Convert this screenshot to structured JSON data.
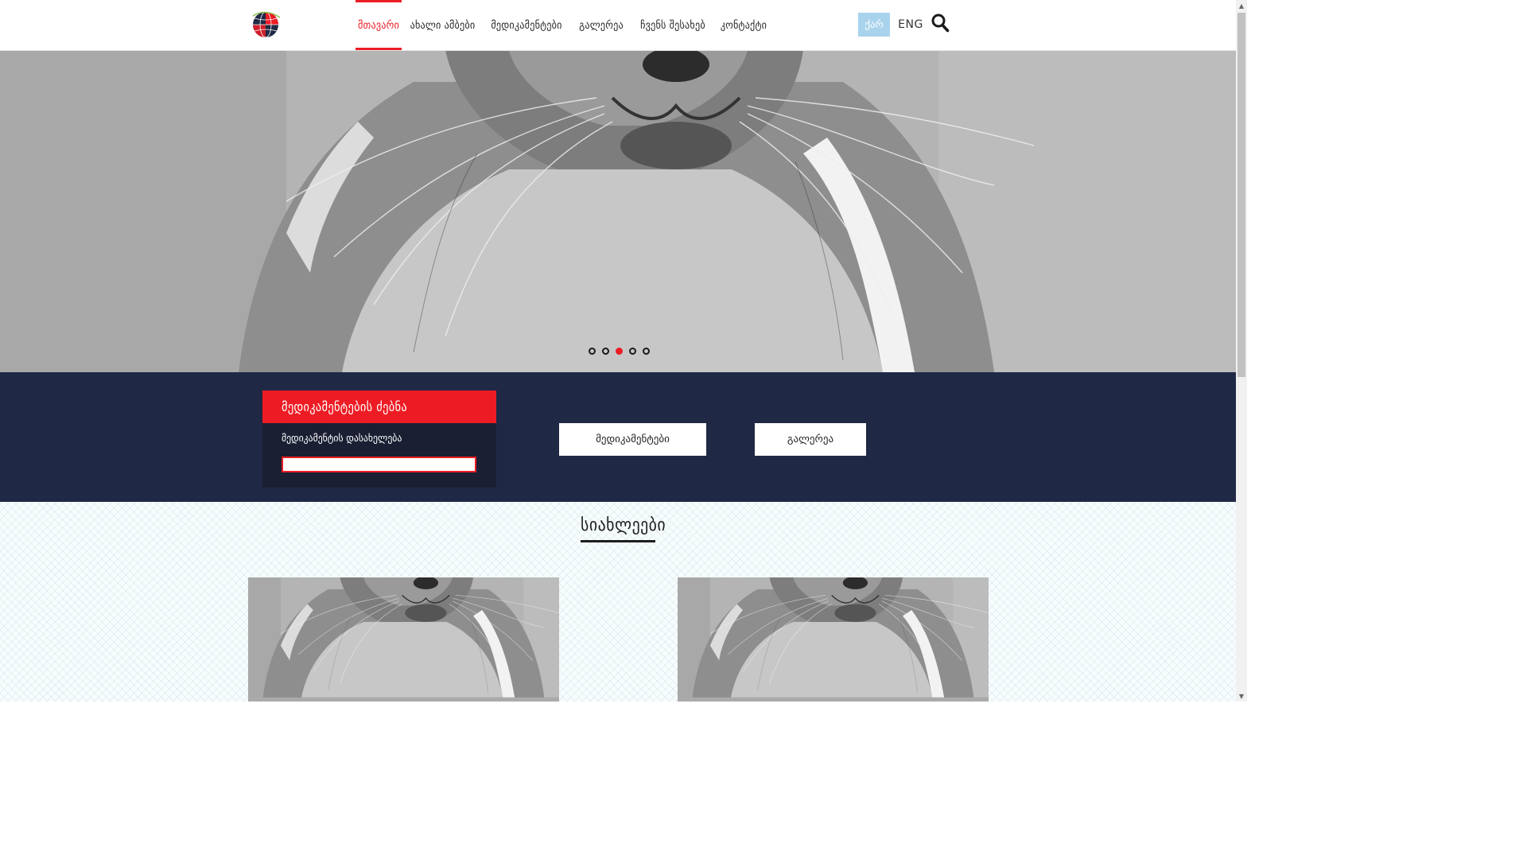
{
  "header": {
    "logo_icon": "globe-logo-icon",
    "nav": [
      {
        "label": "მთავარი",
        "active": true
      },
      {
        "label": "ახალი ამბები",
        "active": false
      },
      {
        "label": "მედიკამენტები",
        "active": false
      },
      {
        "label": "გალერეა",
        "active": false
      },
      {
        "label": "ჩვენს შესახებ",
        "active": false
      },
      {
        "label": "კონტაქტი",
        "active": false
      }
    ],
    "lang_ka": "ქარ",
    "lang_en": "ENG",
    "search_icon": "search-icon"
  },
  "hero": {
    "slides": 5,
    "active_slide": 3
  },
  "finder": {
    "title": "მედიკამენტების ძებნა",
    "label": "მედიკამენტის დასახელება",
    "input_value": ""
  },
  "band_buttons": {
    "medications": "მედიკამენტები",
    "gallery": "გალერეა"
  },
  "news": {
    "title": "სიახლეები",
    "cards": 2
  },
  "colors": {
    "accent": "#ed1c24",
    "navy": "#1f2945",
    "lang_active": "#a9d3ec"
  }
}
